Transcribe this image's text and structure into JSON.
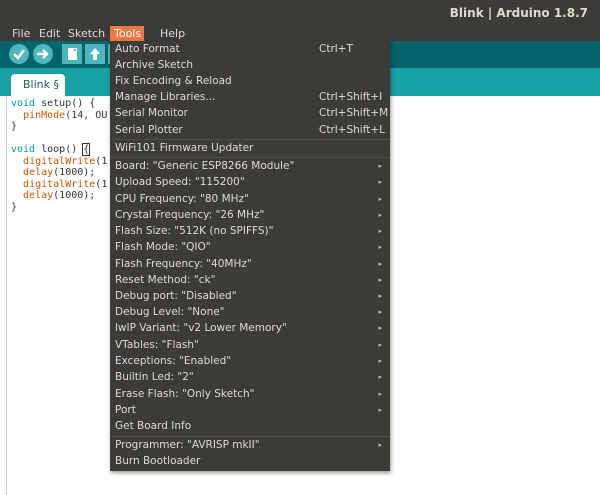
{
  "window": {
    "title": "Blink | Arduino 1.8.7"
  },
  "menubar": {
    "items": [
      "File",
      "Edit",
      "Sketch",
      "Tools",
      "Help"
    ]
  },
  "toolbar": {
    "verify_icon": "checkmark-icon",
    "upload_icon": "arrow-right-icon",
    "new_icon": "new-document-icon",
    "open_icon": "arrow-up-icon",
    "save_icon": "arrow-down-icon"
  },
  "tab": {
    "label": "Blink §"
  },
  "code": {
    "lines": [
      "void setup() {",
      "  pinMode(14, OU",
      "}",
      "",
      "void loop() {",
      "  digitalWrite(1",
      "  delay(1000);",
      "  digitalWrite(1",
      "  delay(1000);",
      "}"
    ]
  },
  "tools_menu": {
    "auto_format": {
      "label": "Auto Format",
      "shortcut": "Ctrl+T"
    },
    "archive_sketch": {
      "label": "Archive Sketch"
    },
    "fix_encoding": {
      "label": "Fix Encoding & Reload"
    },
    "manage_libraries": {
      "label": "Manage Libraries...",
      "shortcut": "Ctrl+Shift+I"
    },
    "serial_monitor": {
      "label": "Serial Monitor",
      "shortcut": "Ctrl+Shift+M"
    },
    "serial_plotter": {
      "label": "Serial Plotter",
      "shortcut": "Ctrl+Shift+L"
    },
    "wifi101_updater": {
      "label": "WiFi101 Firmware Updater"
    },
    "board": {
      "label": "Board: \"Generic ESP8266 Module\""
    },
    "upload_speed": {
      "label": "Upload Speed: \"115200\""
    },
    "cpu_frequency": {
      "label": "CPU Frequency: \"80 MHz\""
    },
    "crystal_frequency": {
      "label": "Crystal Frequency: \"26 MHz\""
    },
    "flash_size": {
      "label": "Flash Size: \"512K (no SPIFFS)\""
    },
    "flash_mode": {
      "label": "Flash Mode: \"QIO\""
    },
    "flash_frequency": {
      "label": "Flash Frequency: \"40MHz\""
    },
    "reset_method": {
      "label": "Reset Method: \"ck\""
    },
    "debug_port": {
      "label": "Debug port: \"Disabled\""
    },
    "debug_level": {
      "label": "Debug Level: \"None\""
    },
    "lwip_variant": {
      "label": "lwIP Variant: \"v2 Lower Memory\""
    },
    "vtables": {
      "label": "VTables: \"Flash\""
    },
    "exceptions": {
      "label": "Exceptions: \"Enabled\""
    },
    "builtin_led": {
      "label": "Builtin Led: \"2\""
    },
    "erase_flash": {
      "label": "Erase Flash: \"Only Sketch\""
    },
    "port": {
      "label": "Port"
    },
    "get_board_info": {
      "label": "Get Board Info"
    },
    "programmer": {
      "label": "Programmer: \"AVRISP mkII\""
    },
    "burn_bootloader": {
      "label": "Burn Bootloader"
    },
    "submenu_arrow": "▸"
  },
  "colors": {
    "menu_bg": "#3c3b37",
    "menu_active": "#f07746",
    "toolbar_bg": "#006468",
    "tabstrip_bg": "#17a1a5",
    "button_fg": "#4db7bb"
  }
}
